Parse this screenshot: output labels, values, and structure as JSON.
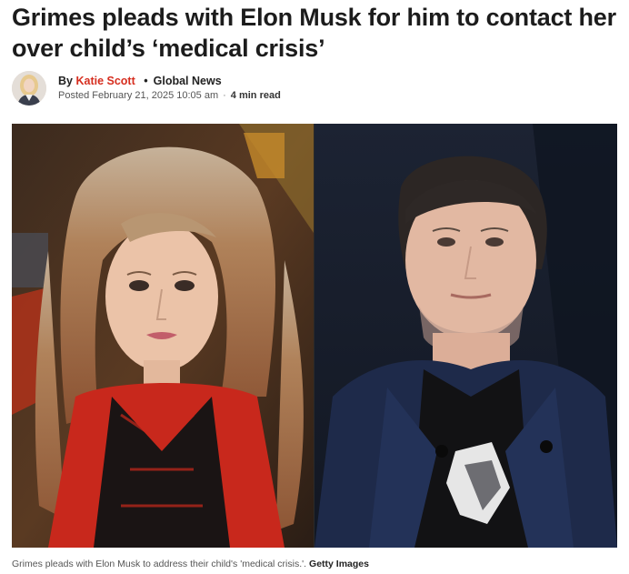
{
  "article": {
    "headline": "Grimes pleads with Elon Musk for him to contact her over child’s ‘medical crisis’",
    "byline": {
      "by_prefix": "By",
      "author": "Katie Scott",
      "separator": "•",
      "outlet": "Global News",
      "posted": "Posted February 21, 2025 10:05 am",
      "meta_separator": "·",
      "read_time": "4 min read"
    },
    "image": {
      "caption": "Grimes pleads with Elon Musk to address their child's 'medical crisis.'.",
      "credit": "Getty Images"
    }
  },
  "colors": {
    "author_link": "#d62e1f",
    "headline": "#1c1c1c",
    "meta": "#555555"
  }
}
